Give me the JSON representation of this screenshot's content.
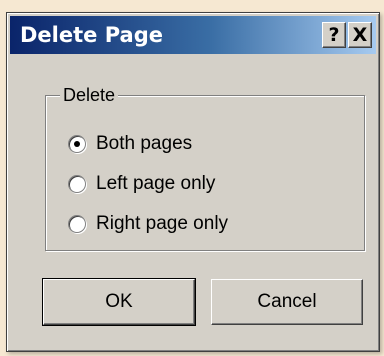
{
  "window": {
    "title": "Delete Page",
    "help_label": "?",
    "close_label": "X"
  },
  "group": {
    "legend": "Delete",
    "options": [
      {
        "label": "Both pages",
        "selected": true
      },
      {
        "label": "Left page only",
        "selected": false
      },
      {
        "label": "Right page only",
        "selected": false
      }
    ]
  },
  "buttons": {
    "ok": "OK",
    "cancel": "Cancel"
  }
}
